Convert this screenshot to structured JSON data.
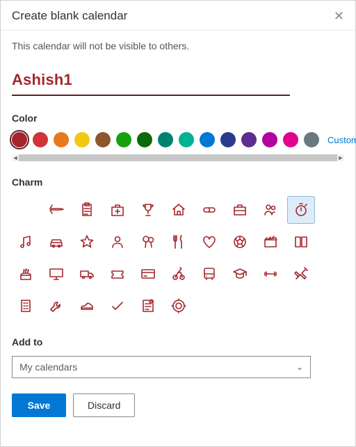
{
  "dialog": {
    "title": "Create blank calendar",
    "close_label": "Close",
    "subtitle": "This calendar will not be visible to others."
  },
  "name": {
    "value": "Ashish1"
  },
  "color_section": {
    "label": "Color",
    "customize_label": "Customize",
    "selected_index": 0,
    "swatches": [
      "#a4262c",
      "#d13438",
      "#e8781e",
      "#f2c811",
      "#8e562e",
      "#13a10e",
      "#0b6a0b",
      "#008272",
      "#00b294",
      "#0078d4",
      "#2b3a8c",
      "#5c2e91",
      "#b4009e",
      "#e3008c",
      "#69797e"
    ]
  },
  "charm_section": {
    "label": "Charm",
    "selected_index": 9,
    "charms": [
      "none",
      "airplane",
      "clipboard",
      "medical-kit",
      "trophy",
      "home",
      "pill",
      "briefcase",
      "people",
      "stopwatch",
      "music",
      "car",
      "star",
      "person",
      "balloons",
      "food",
      "heart",
      "soccer",
      "clapperboard",
      "book",
      "cake",
      "monitor",
      "truck",
      "ticket",
      "credit-card",
      "cycling",
      "bus",
      "graduation",
      "dumbbell",
      "tools",
      "building",
      "wrench",
      "shoe",
      "checkmark",
      "notes",
      "target"
    ]
  },
  "add_to": {
    "label": "Add to",
    "value": "My calendars"
  },
  "buttons": {
    "save": "Save",
    "discard": "Discard"
  }
}
